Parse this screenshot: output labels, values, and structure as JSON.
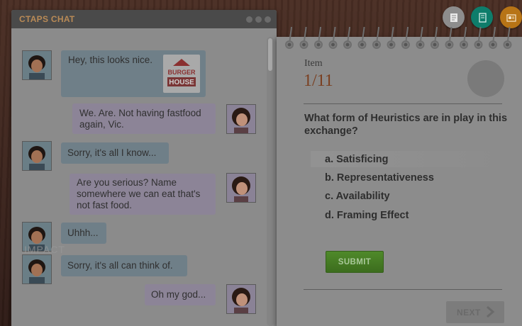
{
  "chat": {
    "title": "CTAPS CHAT",
    "watermark": "IMPACT",
    "messages": [
      {
        "side": "left",
        "sender": "Vic",
        "text": "Hey, this looks nice.",
        "attachment": {
          "logo_top": "BURGER",
          "logo_bottom": "HOUSE"
        }
      },
      {
        "side": "right",
        "sender": "Friend",
        "lines": [
          "We. Are. Not having fastfood",
          "again, Vic."
        ]
      },
      {
        "side": "left",
        "sender": "Vic",
        "text": "Sorry, it's all I know..."
      },
      {
        "side": "right",
        "sender": "Friend",
        "lines": [
          "Are you serious? Name",
          "somewhere we can eat that's",
          "not fast food."
        ]
      },
      {
        "side": "left",
        "sender": "Vic",
        "text": "Uhhh..."
      },
      {
        "side": "left",
        "sender": "Vic",
        "text": "Sorry, it's all can think of."
      },
      {
        "side": "right",
        "sender": "Friend",
        "text": "Oh my god..."
      }
    ]
  },
  "toolbar": {
    "icons": [
      "notes-icon",
      "book-icon",
      "id-card-icon"
    ],
    "colors": {
      "notes": "#8d8d8d",
      "book": "#0e7d6b",
      "card": "#b77416"
    }
  },
  "quiz": {
    "item_label": "Item",
    "item_count": "1/11",
    "question": "What form of Heuristics are in play in this exchange?",
    "options": [
      {
        "label": "a. Satisficing",
        "highlighted": true
      },
      {
        "label": "b. Representativeness",
        "highlighted": false
      },
      {
        "label": "c. Availability",
        "highlighted": false
      },
      {
        "label": "d. Framing Effect",
        "highlighted": false
      }
    ],
    "submit_label": "SUBMIT",
    "next_label": "NEXT"
  },
  "colors": {
    "submit_green": "#4f8a2a",
    "accent_orange": "#7a3f20",
    "chat_title": "#b98a56"
  }
}
